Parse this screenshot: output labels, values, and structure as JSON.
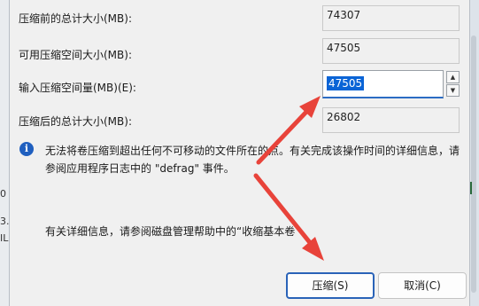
{
  "background": {
    "fragments": [
      "0",
      "3.",
      "IL"
    ]
  },
  "fields": [
    {
      "label": "压缩前的总计大小(MB):",
      "value": "74307"
    },
    {
      "label": "可用压缩空间大小(MB):",
      "value": "47505"
    },
    {
      "label": "输入压缩空间量(MB)(E):",
      "value": "47505"
    },
    {
      "label": "压缩后的总计大小(MB):",
      "value": "26802"
    }
  ],
  "info": {
    "text_line1": "无法将卷压缩到超出任何不可移动的文件所在的点。有关完成该操作时间的详细信息，请",
    "text_line2": "参阅应用程序日志中的 \"defrag\" 事件。"
  },
  "help": {
    "text": "有关详细信息，请参阅磁盘管理帮助中的“收缩基本卷"
  },
  "buttons": {
    "shrink": "压缩(S)",
    "cancel": "取消(C)"
  },
  "colors": {
    "dialog_bg": "#f0f0f0",
    "selection": "#0a64d6",
    "focus": "#2a63b8",
    "arrow": "#e8433a"
  }
}
